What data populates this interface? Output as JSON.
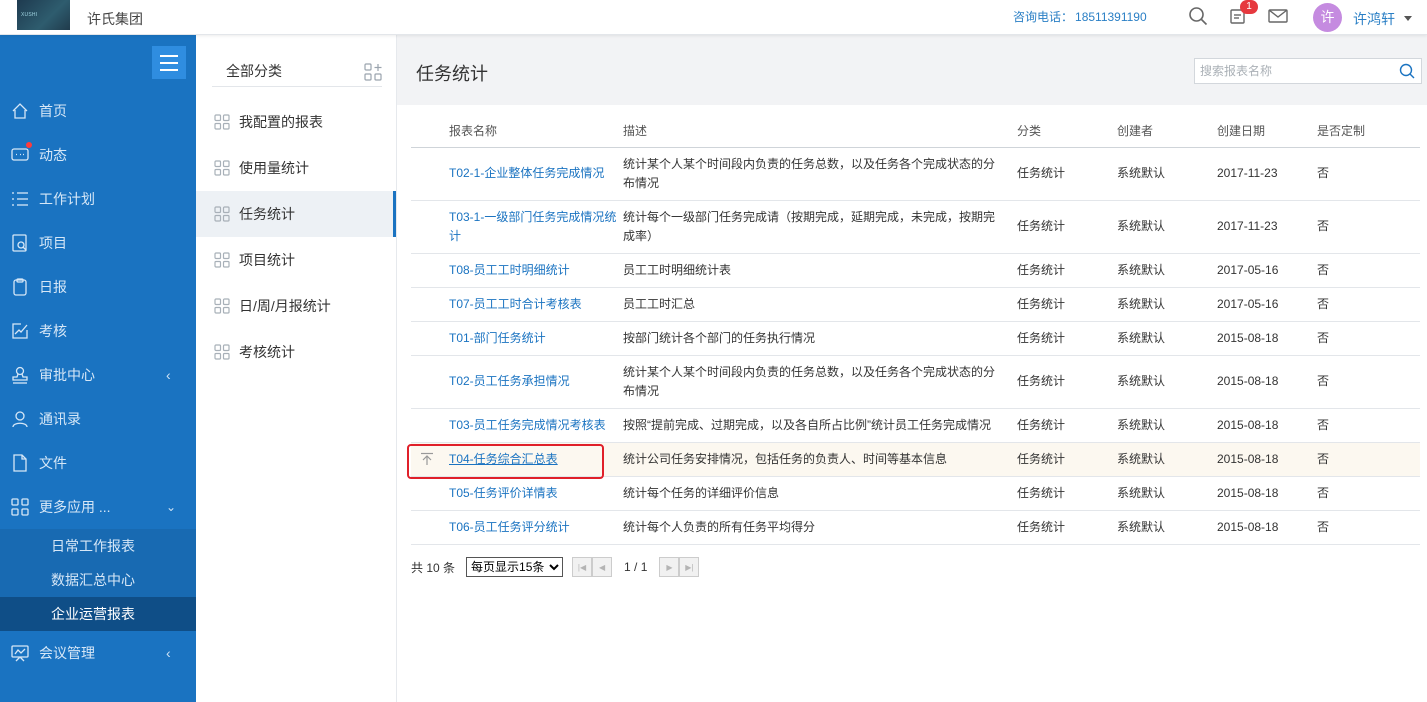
{
  "header": {
    "logo_text": "XUSHI",
    "company": "许氏集团",
    "hotline_label": "咨询电话：",
    "hotline_number": "18511391190",
    "notification_count": "1",
    "avatar_text": "许",
    "username": "许鸿轩"
  },
  "sidebar": {
    "items": [
      {
        "label": "首页",
        "icon": "home-icon"
      },
      {
        "label": "动态",
        "icon": "message-icon"
      },
      {
        "label": "工作计划",
        "icon": "list-icon"
      },
      {
        "label": "项目",
        "icon": "project-icon"
      },
      {
        "label": "日报",
        "icon": "clipboard-icon"
      },
      {
        "label": "考核",
        "icon": "chart-edit-icon"
      },
      {
        "label": "审批中心",
        "icon": "stamp-icon"
      },
      {
        "label": "通讯录",
        "icon": "person-icon"
      },
      {
        "label": "文件",
        "icon": "file-icon"
      },
      {
        "label": "更多应用 ...",
        "icon": "apps-icon"
      },
      {
        "label": "会议管理",
        "icon": "meeting-icon"
      }
    ],
    "sub_items": [
      {
        "label": "日常工作报表"
      },
      {
        "label": "数据汇总中心"
      },
      {
        "label": "企业运营报表"
      }
    ]
  },
  "categories": {
    "title": "全部分类",
    "items": [
      {
        "label": "我配置的报表"
      },
      {
        "label": "使用量统计"
      },
      {
        "label": "任务统计"
      },
      {
        "label": "项目统计"
      },
      {
        "label": "日/周/月报统计"
      },
      {
        "label": "考核统计"
      }
    ]
  },
  "main": {
    "title": "任务统计",
    "search_placeholder": "搜索报表名称",
    "columns": [
      "报表名称",
      "描述",
      "分类",
      "创建者",
      "创建日期",
      "是否定制"
    ],
    "rows": [
      {
        "name": "T02-1-企业整体任务完成情况",
        "desc": "统计某个人某个时间段内负责的任务总数，以及任务各个完成状态的分布情况",
        "category": "任务统计",
        "creator": "系统默认",
        "date": "2017-11-23",
        "custom": "否"
      },
      {
        "name": "T03-1-一级部门任务完成情况统计",
        "desc": "统计每个一级部门任务完成请（按期完成，延期完成，未完成，按期完成率）",
        "category": "任务统计",
        "creator": "系统默认",
        "date": "2017-11-23",
        "custom": "否"
      },
      {
        "name": "T08-员工工时明细统计",
        "desc": "员工工时明细统计表",
        "category": "任务统计",
        "creator": "系统默认",
        "date": "2017-05-16",
        "custom": "否"
      },
      {
        "name": "T07-员工工时合计考核表",
        "desc": "员工工时汇总",
        "category": "任务统计",
        "creator": "系统默认",
        "date": "2017-05-16",
        "custom": "否"
      },
      {
        "name": "T01-部门任务统计",
        "desc": "按部门统计各个部门的任务执行情况",
        "category": "任务统计",
        "creator": "系统默认",
        "date": "2015-08-18",
        "custom": "否"
      },
      {
        "name": "T02-员工任务承担情况",
        "desc": "统计某个人某个时间段内负责的任务总数，以及任务各个完成状态的分布情况",
        "category": "任务统计",
        "creator": "系统默认",
        "date": "2015-08-18",
        "custom": "否"
      },
      {
        "name": "T03-员工任务完成情况考核表",
        "desc": "按照“提前完成、过期完成，以及各自所占比例”统计员工任务完成情况",
        "category": "任务统计",
        "creator": "系统默认",
        "date": "2015-08-18",
        "custom": "否"
      },
      {
        "name": "T04-任务综合汇总表",
        "desc": "统计公司任务安排情况，包括任务的负责人、时间等基本信息",
        "category": "任务统计",
        "creator": "系统默认",
        "date": "2015-08-18",
        "custom": "否"
      },
      {
        "name": "T05-任务评价详情表",
        "desc": "统计每个任务的详细评价信息",
        "category": "任务统计",
        "creator": "系统默认",
        "date": "2015-08-18",
        "custom": "否"
      },
      {
        "name": "T06-员工任务评分统计",
        "desc": "统计每个人负责的所有任务平均得分",
        "category": "任务统计",
        "creator": "系统默认",
        "date": "2015-08-18",
        "custom": "否"
      }
    ],
    "pager": {
      "total": "共 10 条",
      "page_size": "每页显示15条",
      "page_info": "1 / 1"
    }
  },
  "colors": {
    "sidebar_bg": "#1a73c1",
    "link": "#1a73c1",
    "highlight_box": "#e0202a",
    "badge": "#e6393f"
  }
}
